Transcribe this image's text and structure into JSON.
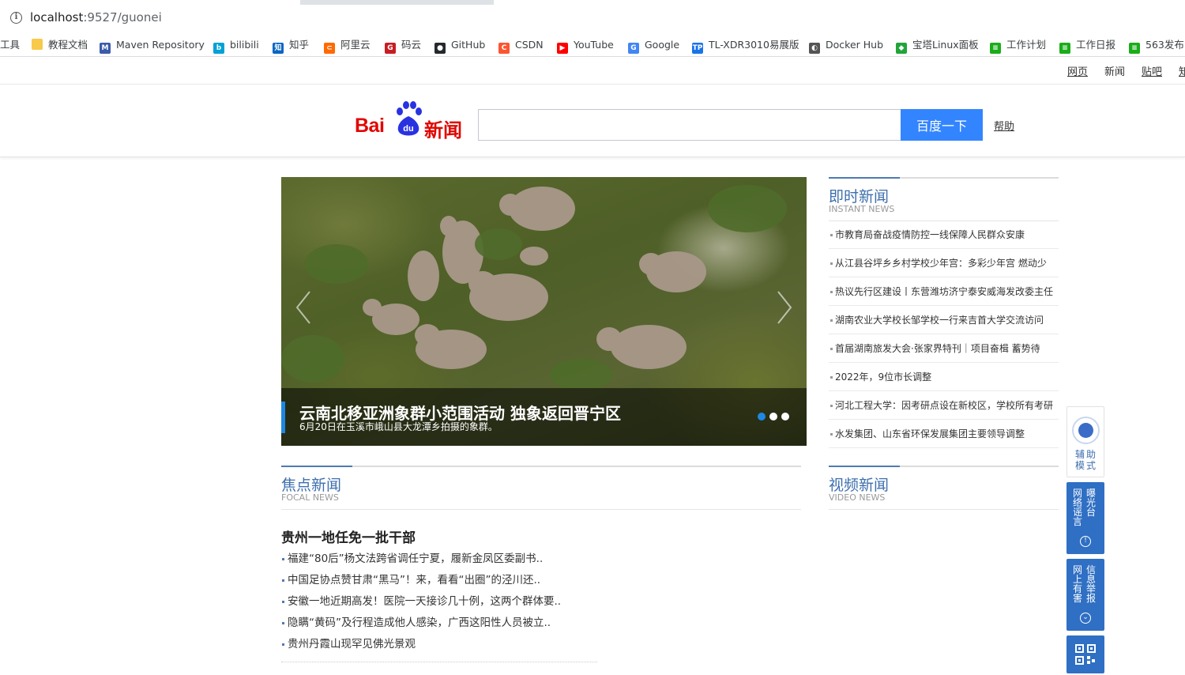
{
  "browser": {
    "url_host": "localhost",
    "url_path": ":9527/guonei",
    "bookmarks": [
      {
        "label": "工具",
        "icon": "none"
      },
      {
        "label": "教程文档",
        "icon": "folder-icon"
      },
      {
        "label": "Maven Repository",
        "icon": "maven-icon"
      },
      {
        "label": "bilibili",
        "icon": "bilibili-icon"
      },
      {
        "label": "知乎",
        "icon": "zhihu-icon"
      },
      {
        "label": "阿里云",
        "icon": "aliyun-icon"
      },
      {
        "label": "码云",
        "icon": "gitee-icon"
      },
      {
        "label": "GitHub",
        "icon": "github-icon"
      },
      {
        "label": "CSDN",
        "icon": "csdn-icon"
      },
      {
        "label": "YouTube",
        "icon": "youtube-icon"
      },
      {
        "label": "Google",
        "icon": "google-icon"
      },
      {
        "label": "TL-XDR3010易展版",
        "icon": "tplink-icon"
      },
      {
        "label": "Docker Hub",
        "icon": "docker-icon"
      },
      {
        "label": "宝塔Linux面板",
        "icon": "baota-icon"
      },
      {
        "label": "工作计划",
        "icon": "sheet-icon"
      },
      {
        "label": "工作日报",
        "icon": "sheet-icon"
      },
      {
        "label": "563发布",
        "icon": "sheet-icon"
      }
    ]
  },
  "topnav": [
    "网页",
    "新闻",
    "贴吧",
    "知"
  ],
  "header": {
    "logo_text_left": "Bai",
    "logo_text_mid": "du",
    "logo_text_right": "新闻",
    "search_value": "",
    "search_button": "百度一下",
    "help_link": "帮助"
  },
  "slideshow": {
    "title": "云南北移亚洲象群小范围活动 独象返回晋宁区",
    "subtitle": "6月20日在玉溪市峨山县大龙潭乡拍摄的象群。",
    "dots": 3,
    "active_dot": 0
  },
  "instant_news": {
    "title_cn": "即时新闻",
    "title_en": "INSTANT NEWS",
    "items": [
      "市教育局奋战疫情防控一线保障人民群众安康",
      "从江县谷坪乡乡村学校少年宫：多彩少年宫 燃动少",
      "热议先行区建设丨东营潍坊济宁泰安威海发改委主任",
      "湖南农业大学校长邹学校一行来吉首大学交流访问",
      "首届湖南旅发大会·张家界特刊｜项目奋楫 蓄势待",
      "2022年，9位市长调整",
      "河北工程大学：因考研点设在新校区，学校所有考研",
      "水发集团、山东省环保发展集团主要领导调整"
    ]
  },
  "focus_news": {
    "title_cn": "焦点新闻",
    "title_en": "FOCAL NEWS",
    "headline": "贵州一地任免一批干部",
    "items": [
      "福建“80后”杨文法跨省调任宁夏，履新金凤区委副书..",
      "中国足协点赞甘肃“黑马”！来，看看“出圈”的泾川还..",
      "安徽一地近期高发！医院一天接诊几十例，这两个群体要..",
      "隐瞒“黄码”及行程造成他人感染，广西这阳性人员被立..",
      "贵州丹霞山现罕见佛光景观"
    ]
  },
  "video_news": {
    "title_cn": "视频新闻",
    "title_en": "VIDEO NEWS"
  },
  "float_tools": {
    "assist_label": "辅助模式",
    "rumor_col1": "网络谣言",
    "rumor_col2": "曝光台",
    "report_col1": "网上有害",
    "report_col2": "信息举报"
  },
  "colors": {
    "brand_red": "#e10601",
    "search_blue": "#3385ff",
    "heading_blue": "#3e6fae",
    "tool_blue": "#2f6fc4"
  }
}
